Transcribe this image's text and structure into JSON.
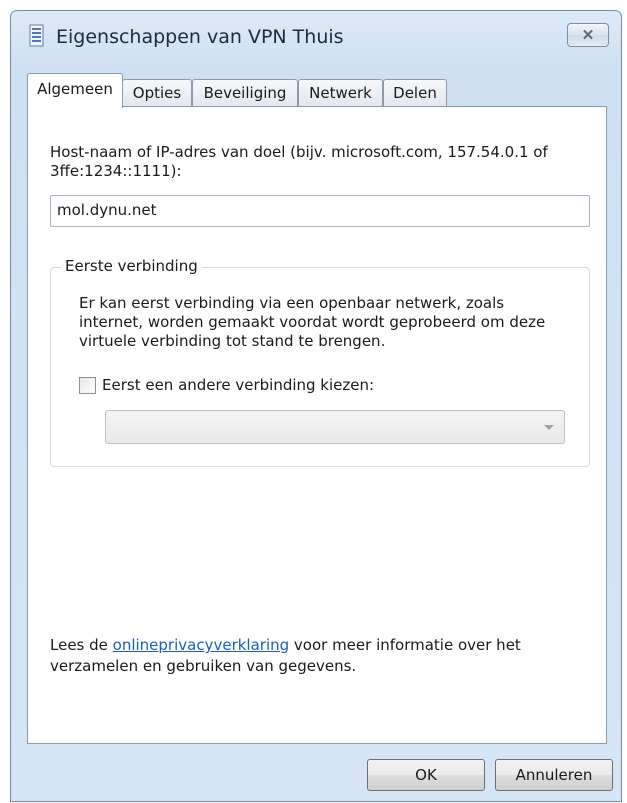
{
  "window": {
    "title": "Eigenschappen van VPN Thuis",
    "close_symbol": "✕",
    "icon": "document-icon"
  },
  "tabs": [
    {
      "label": "Algemeen",
      "active": true
    },
    {
      "label": "Opties",
      "active": false
    },
    {
      "label": "Beveiliging",
      "active": false
    },
    {
      "label": "Netwerk",
      "active": false
    },
    {
      "label": "Delen",
      "active": false
    }
  ],
  "general": {
    "host_label": "Host-naam of IP-adres van doel (bijv. microsoft.com, 157.54.0.1 of 3ffe:1234::1111):",
    "host_value": "mol.dynu.net",
    "first_connection": {
      "legend": "Eerste verbinding",
      "description": "Er kan eerst verbinding via een openbaar netwerk, zoals internet, worden gemaakt voordat wordt geprobeerd om deze virtuele verbinding tot stand te brengen.",
      "checkbox_label": "Eerst een andere verbinding kiezen:",
      "checkbox_checked": false,
      "dropdown_value": ""
    },
    "privacy": {
      "prefix": "Lees de ",
      "link": "onlineprivacyverklaring",
      "suffix": " voor meer informatie over het verzamelen en gebruiken van gegevens."
    }
  },
  "buttons": {
    "ok": "OK",
    "cancel": "Annuleren"
  }
}
